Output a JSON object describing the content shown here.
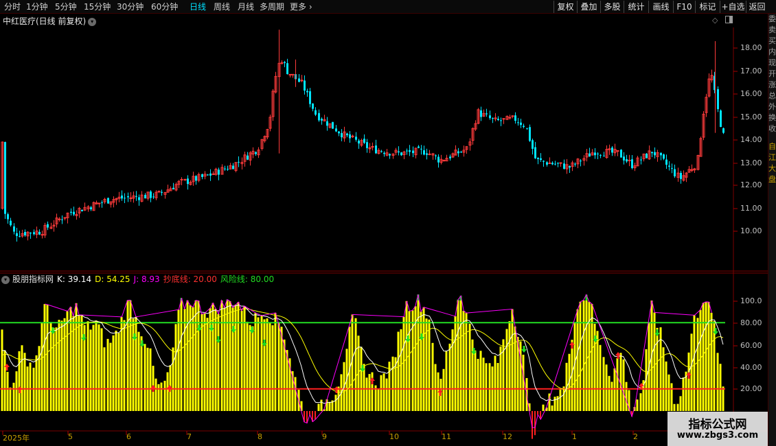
{
  "toolbar": {
    "periods": [
      "分时",
      "1分钟",
      "5分钟",
      "15分钟",
      "30分钟",
      "60分钟",
      "日线",
      "周线",
      "月线",
      "多周期",
      "更多"
    ],
    "active_period": "日线",
    "right_buttons": [
      "复权",
      "叠加",
      "多股",
      "统计",
      "画线",
      "F10",
      "标记",
      "+自选",
      "返回"
    ]
  },
  "stock": {
    "title": "中红医疗(日线 前复权)"
  },
  "indicator": {
    "name": "股朋指标网",
    "k": "K: 39.14",
    "d": "D: 54.25",
    "j": "J: 8.93",
    "bottom_line": "抄底线: 20.00",
    "risk_line": "风险线: 80.00"
  },
  "right_strip_chars": [
    "委",
    "卖",
    "买",
    "内",
    "现",
    "开",
    "涨",
    "总",
    "外",
    "换",
    "收"
  ],
  "right_strip_lower": [
    "自",
    "江",
    "大",
    "盘"
  ],
  "price_axis": [
    "18.00",
    "17.00",
    "16.00",
    "15.00",
    "14.00",
    "13.00",
    "12.00",
    "11.00",
    "10.00"
  ],
  "ind_axis": [
    "100.0",
    "80.00",
    "60.00",
    "40.00",
    "20.00"
  ],
  "x_axis": [
    "2025年",
    "5",
    "6",
    "7",
    "8",
    "9",
    "10",
    "11",
    "12",
    "1",
    "2"
  ],
  "watermark": {
    "line1": "指标公式网",
    "line2": "www.zbgs3.com"
  },
  "colors": {
    "up": "#ff3b3b",
    "down": "#00e5ff",
    "kdj_bar": "#ffff00",
    "risk_line": "#22dd22",
    "bottom_line": "#ff2020",
    "k_line": "#ffffff",
    "d_line": "#ffff00",
    "j_line": "#ff00ff"
  }
}
